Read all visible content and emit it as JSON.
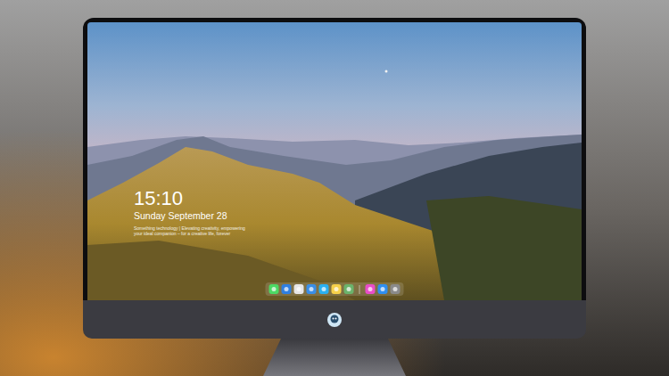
{
  "lock_screen": {
    "time": "15:10",
    "date": "Sunday September 28",
    "caption": [
      "Something technology | Elevating creativity, empowering",
      "your ideal companion – for a creative life, forever"
    ]
  },
  "dock": {
    "apps": [
      {
        "color": "#4cd964"
      },
      {
        "color": "#2f7fe0"
      },
      {
        "color": "#e6e6e6"
      },
      {
        "color": "#3a8ee6"
      },
      {
        "color": "#2ab0f0"
      },
      {
        "color": "#f5d04a"
      },
      {
        "color": "#6bb36b"
      }
    ],
    "recent": [
      {
        "color": "#e84ec8"
      },
      {
        "color": "#2f8ff0"
      },
      {
        "color": "#8a8a8a"
      }
    ]
  }
}
